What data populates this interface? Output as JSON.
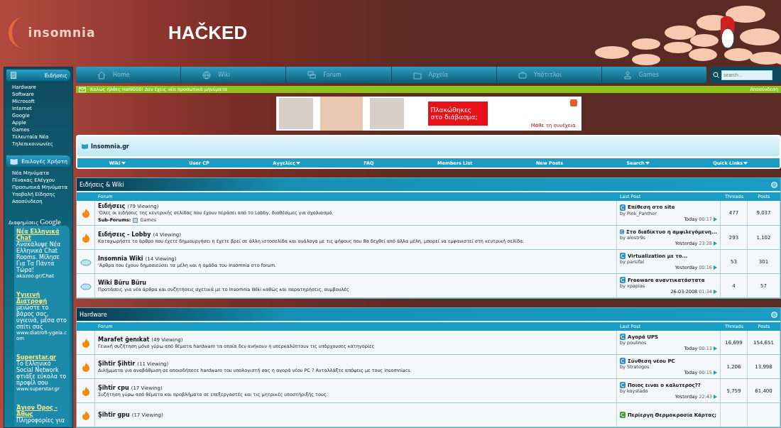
{
  "header": {
    "logo": "insomnia",
    "banner_text": "HAČKED"
  },
  "sidebar": {
    "sections": [
      {
        "title": "Ειδήσεις",
        "kind": "news",
        "items": [
          "Hardware",
          "Software",
          "Microsoft",
          "Internet",
          "Google",
          "Apple",
          "Games",
          "Τελευταία Νέα",
          "Τηλεπικοινωνίες"
        ]
      },
      {
        "title": "Επιλογές Χρήστη",
        "kind": "book",
        "items": [
          "Νέα Μηνύματα",
          "Πίνακας Ελέγχου",
          "Προσωπικά Μηνύματα",
          "Υποβολή Είδησης",
          "Αποσύνδεση"
        ]
      }
    ],
    "ads": {
      "label": "Διαφημίσεις",
      "brand": "Google",
      "items": [
        {
          "title": "Νέα Ελληνικά Chat",
          "text": "Ανακάλυψε Νέα Ελληνικά Chat Rooms. Μίλησε Για Τα Πάντα Τώρα!",
          "url": "akazoo.gr/Chat"
        },
        {
          "title": "Υγιεινή Διατροφή",
          "text": "μειώστε το βάρος σας, υγιεινά, μέσα στο σπίτι σας",
          "url": "www.diatrofi-ygeia.com"
        },
        {
          "title": "Superstar.gr",
          "text": "Το Ελληνικό Social Network φτιάξε εύκολα το προφίλ σου",
          "url": "www.superstar.gr"
        },
        {
          "title": "Άγιον Όρος - Άθως",
          "text": "Πληροφορίες για"
        }
      ]
    }
  },
  "nav": {
    "tabs": [
      {
        "label": "Home",
        "kind": "home"
      },
      {
        "label": "Wiki",
        "kind": "globe"
      },
      {
        "label": "Forum",
        "kind": "forum"
      },
      {
        "label": "Αρχεία",
        "kind": "files"
      },
      {
        "label": "Υπότιτλοι",
        "kind": "subs"
      },
      {
        "label": "Games",
        "kind": "games"
      }
    ],
    "search": {
      "placeholder": "search..."
    }
  },
  "welcome": {
    "message": "Καλώς ήλθες Hal9000! Δεν έχεις νέα προσωπικά μηνύματα",
    "logout": "Αποσύνδεση"
  },
  "ad_banner": {
    "headline": "Πλακώθηκες στο διάβασμα;",
    "link": "Μάθε τη συνέχεια"
  },
  "navbar": {
    "title": "Insomnia.gr",
    "menu": [
      {
        "label": "Wiki",
        "has_menu": true
      },
      {
        "label": "User CP",
        "has_menu": false
      },
      {
        "label": "Αγγελίες",
        "has_menu": true
      },
      {
        "label": "FAQ",
        "has_menu": false
      },
      {
        "label": "Members List",
        "has_menu": false
      },
      {
        "label": "New Posts",
        "has_menu": false
      },
      {
        "label": "Search",
        "has_menu": true
      },
      {
        "label": "Quick Links",
        "has_menu": true
      }
    ]
  },
  "sections": [
    {
      "title": "Ειδήσεις & Wiki",
      "columns": [
        "Forum",
        "Last Post",
        "Threads",
        "Posts"
      ],
      "rows": [
        {
          "kind": "flame",
          "title": "Ειδήσεις",
          "viewing": "(79 Viewing)",
          "description": "'Ολες οι ειδήσεις της κεντρικής σελίδας που έχουν περάσει από το Lobby, διαθέσιμες για σχολιασμό.",
          "subforums": {
            "label": "Sub-Forums:",
            "items": [
              "Games"
            ]
          },
          "last_post": {
            "title": "Επίθεση στο site",
            "by": "by Pink_Panther",
            "date": "Today",
            "time": "00:17",
            "color": "#2f8fc4"
          },
          "threads": "477",
          "posts": "9,037"
        },
        {
          "kind": "flame",
          "title": "Ειδήσεις - Lobby",
          "viewing": "(4 Viewing)",
          "description": "Καταχωρήστε το άρθρο που έχετε δημιουργήσει η έχετε βρεί σε άλλη ιστοσελίδα και ανάλογα με τις ψήφους που θα δεχθεί από άλλα μέλη, μπορεί να εμφανιστεί στη κεντρική σελίδα.",
          "last_post": {
            "title": "Στο διαδίκτυο η αμφιλεγόμενη...",
            "by": "by alestr9s",
            "date": "Yesterday",
            "time": "23:28",
            "color": "#2f8fc4"
          },
          "threads": "293",
          "posts": "1,102"
        },
        {
          "kind": "cloud",
          "title": "Insomnia Wiki",
          "viewing": "(14 Viewing)",
          "description": "'Αρθρα που έχουν δημοσιεύσει τα μέλη και η ομάδα του Insomnia στο forum.",
          "last_post": {
            "title": "Virtualization με το...",
            "by": "by parsifal",
            "date": "Yesterday",
            "time": "00:16",
            "color": "#2f8fc4"
          },
          "threads": "53",
          "posts": "301"
        },
        {
          "kind": "cloud",
          "title": "Wiki Būru Būru",
          "description": "Προτάσεις για νέα άρθρα και συζητήσεις σχετικά με το Insomnia Wiki καθώς και παρατηρήσεις, συμβουλές",
          "last_post": {
            "title": "Freeware αναντικατάστατα",
            "by": "by xpapias",
            "date": "26-03-2008",
            "time": "01:34",
            "color": "#2f8fc4"
          },
          "threads": "4",
          "posts": "57"
        }
      ]
    },
    {
      "title": "Hardware",
      "columns": [
        "Forum",
        "Last Post",
        "Threads",
        "Posts"
      ],
      "rows": [
        {
          "kind": "flame",
          "title": "Marafet ğenıkat",
          "viewing": "(49 Viewing)",
          "description": "Γενική συζήτηση μόνο γύρω από θέματα hardware τα οποία δεν ανήκουν η υπερκαλύπτουν τις υπάρχουσες κατηγορίες",
          "last_post": {
            "title": "Αγορά UPS",
            "by": "by poulinos",
            "date": "Today",
            "time": "00:13",
            "color": "#2f8fc4"
          },
          "threads": "16,699",
          "posts": "154,651"
        },
        {
          "kind": "flame",
          "title": "Şihtir Şihtir",
          "viewing": "(11 Viewing)",
          "description": "Διλήμματα για αναβάθμιση σε οποιοδήποτε hardware του υπολογιστή σας η αγορά νέου PC ? Ανταλλάξτε απόψεις με τους insomniacs.",
          "last_post": {
            "title": "Σύνθεση νέου PC",
            "by": "by Strategos",
            "date": "Today",
            "time": "00:15",
            "color": "#2f8fc4"
          },
          "threads": "1,206",
          "posts": "13,998"
        },
        {
          "kind": "flame",
          "title": "Şihtir cpu",
          "viewing": "(17 Viewing)",
          "description": "Συζήτηση γύρω από θέματα και προβλήματα σε επεξεργαστές και τις μητρικές υποστήριξής τους.",
          "last_post": {
            "title": "Ποιος ειναι ο καλυτερος??",
            "by": "by koystado",
            "date": "Yesterday",
            "time": "22:43",
            "color": "#2f8fc4"
          },
          "threads": "5,759",
          "posts": "61,400"
        },
        {
          "kind": "flame",
          "title": "Şihtir gpu",
          "viewing": "(17 Viewing)",
          "last_post": {
            "title": "Περίεργη Θερμοκρασία Κάρτας;",
            "color": "#3a9a2a"
          }
        }
      ]
    }
  ]
}
